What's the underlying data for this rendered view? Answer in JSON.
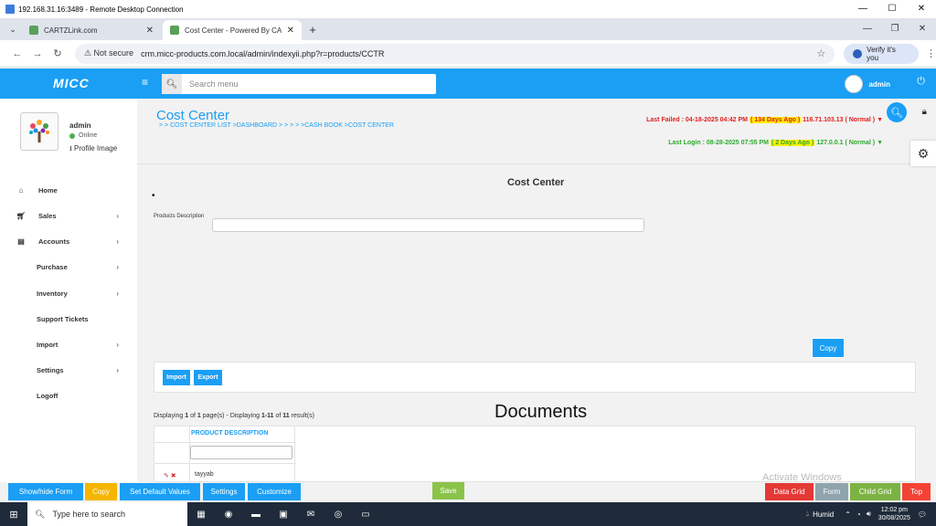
{
  "rdp": {
    "title": "192.168.31.16:3489 - Remote Desktop Connection"
  },
  "browser": {
    "tabs": [
      {
        "label": "CARTZLink.com"
      },
      {
        "label": "Cost Center - Powered By CARTZ"
      }
    ],
    "security_label": "Not secure",
    "url": "crm.micc-products.com.local/admin/indexyii.php?r=products/CCTR",
    "verify_label": "Verify it's you"
  },
  "header": {
    "logo": "MICC",
    "search_placeholder": "Search menu",
    "username": "admin"
  },
  "sidebar": {
    "profile": {
      "name": "admin",
      "status": "Online",
      "image_link": "Profile Image"
    },
    "items": [
      {
        "label": "Home",
        "icon": "home-icon"
      },
      {
        "label": "Sales",
        "icon": "cart-icon"
      },
      {
        "label": "Accounts",
        "icon": "bank-icon"
      },
      {
        "label": "Purchase"
      },
      {
        "label": "Inventory"
      },
      {
        "label": "Support Tickets"
      },
      {
        "label": "Import"
      },
      {
        "label": "Settings"
      },
      {
        "label": "Logoff"
      }
    ]
  },
  "main": {
    "page_title": "Cost Center",
    "breadcrumb": "> > COST CENTER LIST  >DASHBOARD  > > > >  >CASH BOOK  >COST CENTER",
    "last_failed": {
      "prefix": "Last Failed : 04-18-2025 04:42 PM",
      "ago": "( 134 Days Ago )",
      "suffix": "116.71.103.13 ( Normal ) ▼"
    },
    "last_login": {
      "prefix": "Last Login : 08-28-2025 07:55 PM",
      "ago": "( 2 Days Ago )",
      "suffix": "127.0.0.1 ( Normal ) ▼"
    },
    "form_title": "Cost Center",
    "field_label": "Products Description",
    "copy_label": "Copy",
    "import_label": "Import",
    "export_label": "Export",
    "display_info": {
      "prefix": "Displaying ",
      "page": "1",
      "of_text": " of ",
      "pages": "1",
      "mid": " page(s)  -  Displaying ",
      "range": "1-11",
      "of2": " of ",
      "total": "11",
      "suffix": " result(s)"
    },
    "documents_title": "Documents",
    "grid": {
      "column_header": "PRODUCT DESCRIPTION",
      "rows": [
        {
          "value": "tayyab"
        }
      ]
    }
  },
  "toolbar": {
    "show_hide_form": "Show/hide Form",
    "copy": "Copy",
    "set_default": "Set Default Values",
    "settings": "Settings",
    "customize": "Customize",
    "save": "Save",
    "data_grid": "Data Grid",
    "form": "Form",
    "child_grid": "Child Grid",
    "top": "Top"
  },
  "watermark": "Activate Windows",
  "taskbar": {
    "search_placeholder": "Type here to search",
    "weather": "Humid",
    "time": "12:02 pm",
    "date": "30/08/2025"
  },
  "colors": {
    "primary": "#1a9ff5",
    "copy_orange": "#f5b500",
    "save_green": "#8bc34a",
    "data_grid_red": "#e53935",
    "form_grey": "#90a4ae",
    "child_grid_green": "#7cb342",
    "top_red": "#f44336"
  }
}
